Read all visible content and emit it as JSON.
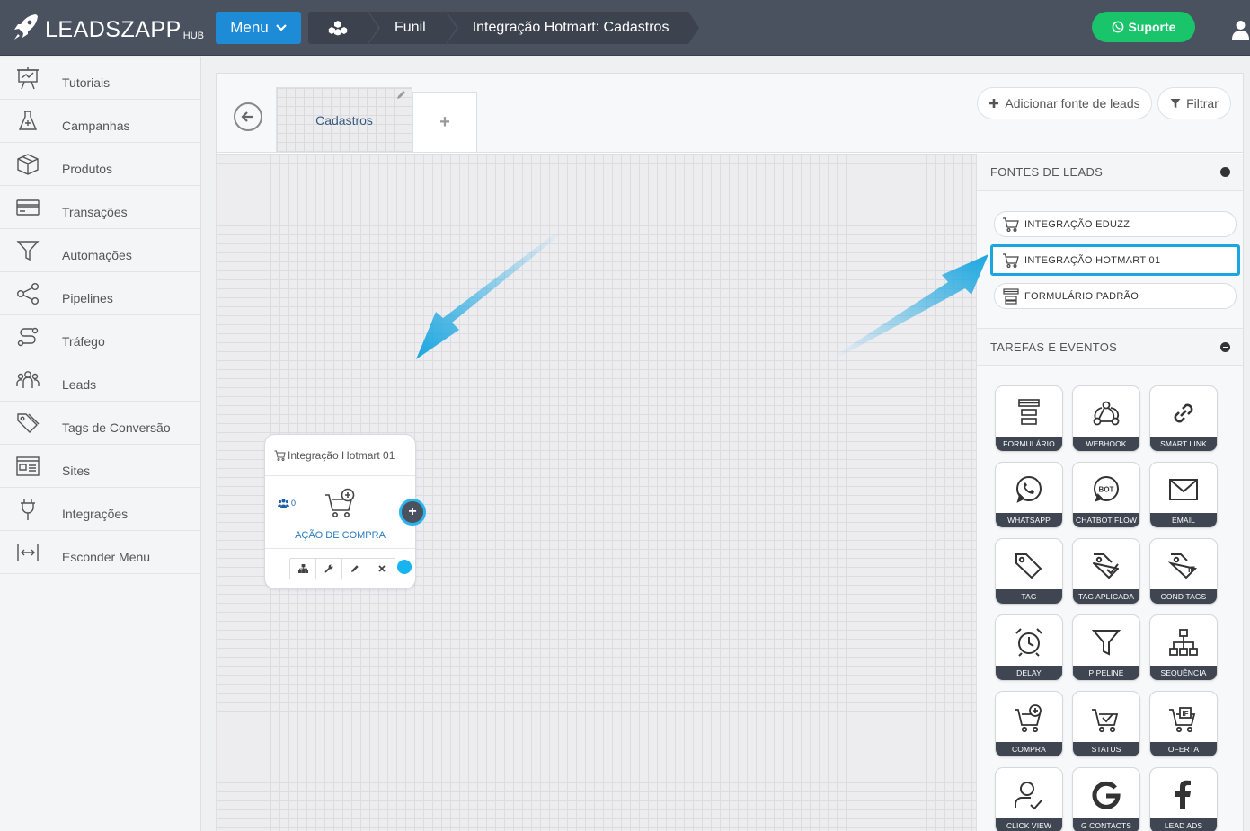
{
  "app": {
    "brand": "LEADSZAPP",
    "brand_sub": "HUB"
  },
  "topbar": {
    "menu_label": "Menu",
    "breadcrumbs": [
      "Funil",
      "Integração Hotmart: Cadastros"
    ],
    "support_label": "Suporte"
  },
  "sidebar": {
    "items": [
      {
        "label": "Tutoriais",
        "icon": "presentation-icon"
      },
      {
        "label": "Campanhas",
        "icon": "flask-icon"
      },
      {
        "label": "Produtos",
        "icon": "box-icon"
      },
      {
        "label": "Transações",
        "icon": "credit-card-icon"
      },
      {
        "label": "Automações",
        "icon": "funnel-icon"
      },
      {
        "label": "Pipelines",
        "icon": "share-icon"
      },
      {
        "label": "Tráfego",
        "icon": "route-icon"
      },
      {
        "label": "Leads",
        "icon": "users-icon"
      },
      {
        "label": "Tags de Conversão",
        "icon": "tags-icon"
      },
      {
        "label": "Sites",
        "icon": "browser-icon"
      },
      {
        "label": "Integrações",
        "icon": "plug-icon"
      },
      {
        "label": "Esconder Menu",
        "icon": "collapse-arrows-icon"
      }
    ]
  },
  "main": {
    "tabs": [
      {
        "label": "Cadastros"
      }
    ],
    "add_tab_label": "+",
    "add_source_label": "Adicionar fonte de leads",
    "filter_label": "Filtrar"
  },
  "node": {
    "title": "Integração Hotmart 01",
    "lead_count": "0",
    "label": "AÇÃO DE COMPRA"
  },
  "right_panel": {
    "sources_title": "FONTES DE LEADS",
    "sources": [
      {
        "label": "INTEGRAÇÃO EDUZZ",
        "icon": "cart-icon"
      },
      {
        "label": "INTEGRAÇÃO HOTMART 01",
        "icon": "cart-icon",
        "selected": true
      },
      {
        "label": "FORMULÁRIO PADRÃO",
        "icon": "form-icon"
      }
    ],
    "tasks_title": "TAREFAS E EVENTOS",
    "tasks": [
      {
        "label": "FORMULÁRIO",
        "icon": "form-icon"
      },
      {
        "label": "WEBHOOK",
        "icon": "webhook-icon"
      },
      {
        "label": "SMART LINK",
        "icon": "link-icon"
      },
      {
        "label": "WHATSAPP",
        "icon": "whatsapp-icon"
      },
      {
        "label": "CHATBOT FLOW",
        "icon": "bot-icon"
      },
      {
        "label": "EMAIL",
        "icon": "envelope-icon"
      },
      {
        "label": "TAG",
        "icon": "tag-icon"
      },
      {
        "label": "TAG APLICADA",
        "icon": "tag-check-icon"
      },
      {
        "label": "COND TAGS",
        "icon": "tag-if-icon"
      },
      {
        "label": "DELAY",
        "icon": "alarm-clock-icon"
      },
      {
        "label": "PIPELINE",
        "icon": "funnel-icon"
      },
      {
        "label": "SEQUÊNCIA",
        "icon": "sitemap-icon"
      },
      {
        "label": "COMPRA",
        "icon": "cart-plus-icon"
      },
      {
        "label": "STATUS",
        "icon": "cart-check-icon"
      },
      {
        "label": "OFERTA",
        "icon": "cart-if-icon"
      },
      {
        "label": "CLICK VIEW",
        "icon": "user-check-icon"
      },
      {
        "label": "G CONTACTS",
        "icon": "google-icon"
      },
      {
        "label": "LEAD ADS",
        "icon": "facebook-icon"
      }
    ]
  },
  "colors": {
    "topbar": "#4a5260",
    "menu_button": "#1d8bd6",
    "support_button": "#19c46a",
    "accent_arrow": "#1aa6e0",
    "tile_label_bg": "#3f4652"
  }
}
